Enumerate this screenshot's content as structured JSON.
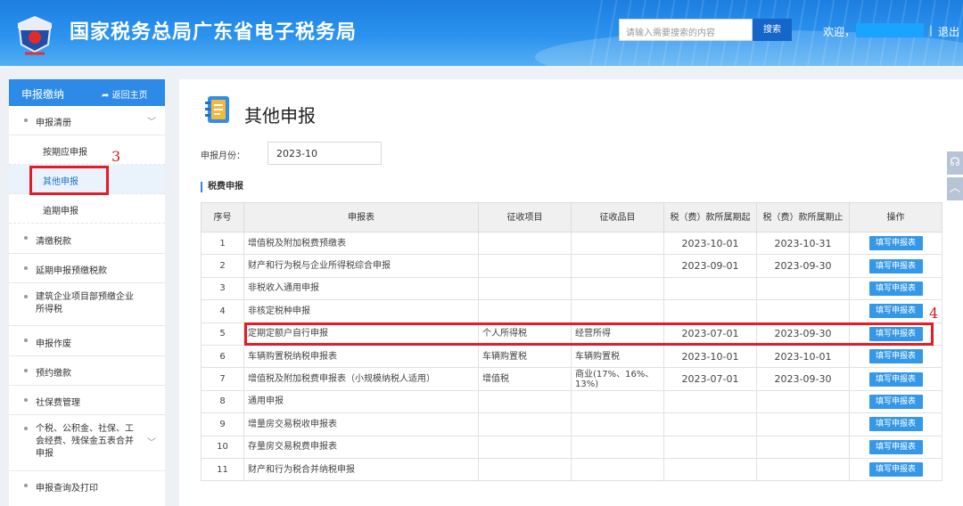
{
  "header": {
    "title": "国家税务总局广东省电子税务局",
    "search_placeholder": "请输入需要搜索的内容",
    "search_button": "搜索",
    "welcome": "欢迎，",
    "separator": "|",
    "logout": "退出",
    "colors": {
      "bar": "#2b93ee",
      "search_button": "#1566c8"
    }
  },
  "sidebar": {
    "title": "申报缴纳",
    "back_label": "返回主页",
    "back_icon": "reply-arrow-icon",
    "groups": [
      {
        "label": "申报清册",
        "expanded": true,
        "children": [
          "按期应申报",
          "其他申报",
          "逾期申报"
        ],
        "active_child": 1
      },
      {
        "label": "清缴税款"
      },
      {
        "label": "延期申报预缴税款"
      },
      {
        "label": "建筑企业项目部预缴企业所得税",
        "lines": [
          "建筑企业项目部预缴企业",
          "所得税"
        ]
      },
      {
        "label": "申报作废"
      },
      {
        "label": "预约缴款"
      },
      {
        "label": "社保费管理"
      },
      {
        "label": "个税、公积金、社保、工会经费、残保金五表合并申报",
        "lines": [
          "个税、公积金、社保、工",
          "会经费、残保金五表合并",
          "申报"
        ],
        "has_chevron": true
      },
      {
        "label": "申报查询及打印"
      }
    ]
  },
  "annotations": {
    "step3": "3",
    "step4": "4",
    "color": "#e21d27"
  },
  "main": {
    "title": "其他申报",
    "month_label": "申报月份：",
    "month_value": "2023-10",
    "section_title": "税费申报",
    "table": {
      "headers": [
        "序号",
        "申报表",
        "征收项目",
        "征收品目",
        "税（费）款所属期起",
        "税（费）款所属期止",
        "操作"
      ],
      "action_label": "填写申报表",
      "rows": [
        {
          "no": "1",
          "form": "增值税及附加税费预缴表",
          "item": "",
          "category": "",
          "start": "2023-10-01",
          "end": "2023-10-31"
        },
        {
          "no": "2",
          "form": "财产和行为税与企业所得税综合申报",
          "item": "",
          "category": "",
          "start": "2023-09-01",
          "end": "2023-09-30"
        },
        {
          "no": "3",
          "form": "非税收入通用申报",
          "item": "",
          "category": "",
          "start": "",
          "end": ""
        },
        {
          "no": "4",
          "form": "非核定税种申报",
          "item": "",
          "category": "",
          "start": "",
          "end": ""
        },
        {
          "no": "5",
          "form": "定期定额户自行申报",
          "item": "个人所得税",
          "category": "经营所得",
          "start": "2023-07-01",
          "end": "2023-09-30",
          "highlighted": true
        },
        {
          "no": "6",
          "form": "车辆购置税纳税申报表",
          "item": "车辆购置税",
          "category": "车辆购置税",
          "start": "2023-10-01",
          "end": "2023-10-01"
        },
        {
          "no": "7",
          "form": "增值税及附加税费申报表（小规模纳税人适用）",
          "item": "增值税",
          "category": "商业(17%、16%、13%)",
          "start": "2023-07-01",
          "end": "2023-09-30"
        },
        {
          "no": "8",
          "form": "通用申报",
          "item": "",
          "category": "",
          "start": "",
          "end": ""
        },
        {
          "no": "9",
          "form": "增量房交易税收申报表",
          "item": "",
          "category": "",
          "start": "",
          "end": ""
        },
        {
          "no": "10",
          "form": "存量房交易税费申报表",
          "item": "",
          "category": "",
          "start": "",
          "end": ""
        },
        {
          "no": "11",
          "form": "财产和行为税合并纳税申报",
          "item": "",
          "category": "",
          "start": "",
          "end": ""
        }
      ]
    }
  },
  "right_rail": {
    "icons": [
      "headset-icon",
      "back-to-top-icon"
    ]
  }
}
